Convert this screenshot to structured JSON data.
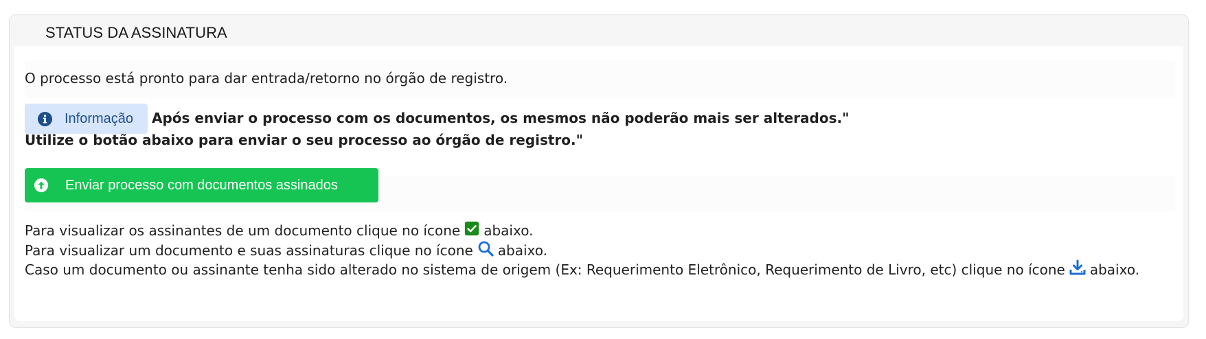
{
  "panel": {
    "title": "STATUS DA ASSINATURA"
  },
  "intro": "O processo está pronto para dar entrada/retorno no órgão de registro.",
  "info": {
    "badge_label": "Informação",
    "badge_icon": "info-circle-icon",
    "line1": "Após enviar o processo com os documentos, os mesmos não poderão mais ser alterados.\"",
    "line2": "Utilize o botão abaixo para enviar o seu processo ao órgão de registro.\""
  },
  "send_button": {
    "label": "Enviar processo com documentos assinados",
    "icon": "arrow-up-circle-icon",
    "color": "#16c453"
  },
  "help": {
    "line1_before": "Para visualizar os assinantes de um documento clique no ícone",
    "line1_after": "abaixo.",
    "line1_icon": "check-square-icon",
    "line2_before": "Para visualizar um documento e suas assinaturas clique no ícone",
    "line2_after": "abaixo.",
    "line2_icon": "search-icon",
    "line3_before": "Caso um documento ou assinante tenha sido alterado no sistema de origem (Ex: Requerimento Eletrônico, Requerimento de Livro, etc) clique no ícone",
    "line3_after": "abaixo.",
    "line3_icon": "download-icon"
  },
  "colors": {
    "check_icon": "#1a8a1a",
    "search_icon": "#1a6fd1",
    "download_icon": "#1a6fd1",
    "info_badge_bg": "#d8e6fb",
    "info_badge_text": "#1e4f8c"
  }
}
